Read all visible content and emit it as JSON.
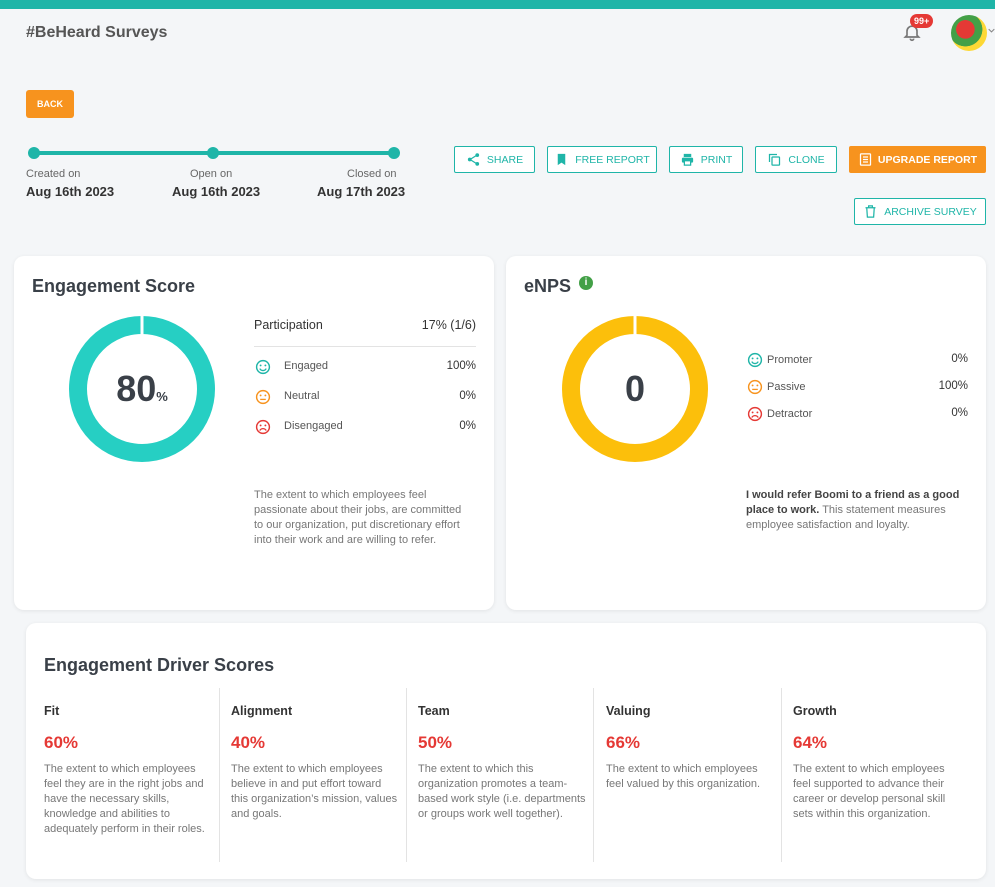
{
  "app": {
    "title": "#BeHeard Surveys",
    "notification_count": "99+"
  },
  "back_label": "BACK",
  "timeline": [
    {
      "label": "Created on",
      "date": "Aug 16th 2023"
    },
    {
      "label": "Open on",
      "date": "Aug 16th 2023"
    },
    {
      "label": "Closed on",
      "date": "Aug 17th 2023"
    }
  ],
  "actions": {
    "share": "SHARE",
    "free_report": "FREE REPORT",
    "print": "PRINT",
    "clone": "CLONE",
    "upgrade_report": "UPGRADE REPORT",
    "archive_survey": "ARCHIVE SURVEY"
  },
  "engagement": {
    "title": "Engagement Score",
    "score": "80",
    "score_unit": "%",
    "score_fraction": 0.8,
    "participation_label": "Participation",
    "participation_value": "17% (1/6)",
    "rows": [
      {
        "label": "Engaged",
        "value": "100%",
        "icon": "smile-icon"
      },
      {
        "label": "Neutral",
        "value": "0%",
        "icon": "neutral-face-icon"
      },
      {
        "label": "Disengaged",
        "value": "0%",
        "icon": "frown-icon"
      }
    ],
    "description": "The extent to which employees feel passionate about their jobs, are committed to our organization, put discretionary effort into their work and are willing to refer."
  },
  "enps": {
    "title": "eNPS",
    "score": "0",
    "rows": [
      {
        "label": "Promoter",
        "value": "0%",
        "icon": "smile-icon"
      },
      {
        "label": "Passive",
        "value": "100%",
        "icon": "neutral-face-icon"
      },
      {
        "label": "Detractor",
        "value": "0%",
        "icon": "frown-icon"
      }
    ],
    "statement_bold": "I would refer Boomi to a friend as a good place to work.",
    "statement_rest": " This statement measures employee satisfaction and loyalty."
  },
  "drivers": {
    "title": "Engagement Driver Scores",
    "items": [
      {
        "name": "Fit",
        "score": "60%",
        "description": "The extent to which employees feel they are in the right jobs and have the necessary skills, knowledge and abilities to adequately perform in their roles."
      },
      {
        "name": "Alignment",
        "score": "40%",
        "description": "The extent to which employees believe in and put effort toward this organization’s mission, values and goals."
      },
      {
        "name": "Team",
        "score": "50%",
        "description": "The extent to which this organization promotes a team-based work style (i.e. departments or groups work well together)."
      },
      {
        "name": "Valuing",
        "score": "66%",
        "description": "The extent to which employees feel valued by this organization."
      },
      {
        "name": "Growth",
        "score": "64%",
        "description": "The extent to which employees feel supported to advance their career or develop personal skill sets within this organization."
      }
    ]
  },
  "colors": {
    "teal": "#1fb5a8",
    "orange": "#f7931e",
    "ring_teal": "#26cfc3",
    "ring_yellow": "#fcbf0b",
    "red": "#e53935",
    "green": "#43a047"
  }
}
